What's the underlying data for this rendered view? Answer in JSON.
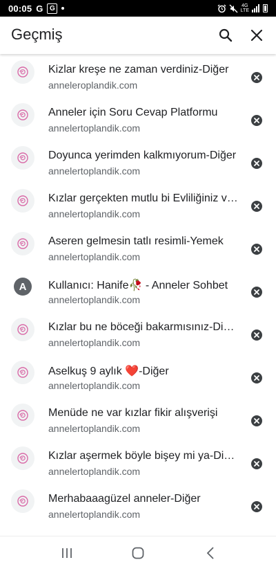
{
  "status_bar": {
    "time": "00:05",
    "left_icons": [
      "google-icon",
      "google-app-icon",
      "notification-dot-icon"
    ],
    "network": "4G",
    "network_sub": "LTE",
    "right_icons": [
      "alarm-icon",
      "mute-icon",
      "network-icon",
      "signal-icon",
      "battery-icon"
    ]
  },
  "header": {
    "title": "Geçmiş",
    "search_icon": "search-icon",
    "close_icon": "close-icon"
  },
  "history": [
    {
      "title": "Kizlar kreşe ne zaman verdiniz-Diğer",
      "url": "anneleroplandik.com",
      "icon": "rose-favicon"
    },
    {
      "title": "Anneler için Soru Cevap Platformu",
      "url": "annelertoplandik.com",
      "icon": "rose-favicon"
    },
    {
      "title": "Doyunca yerimden kalkmıyorum-Diğer",
      "url": "annelertoplandik.com",
      "icon": "rose-favicon"
    },
    {
      "title": "Kızlar gerçekten mutlu bi Evliliğiniz var mı",
      "url": "annelertoplandik.com",
      "icon": "rose-favicon"
    },
    {
      "title": "Aseren gelmesin tatlı resimli-Yemek",
      "url": "annelertoplandik.com",
      "icon": "rose-favicon"
    },
    {
      "title": "Kullanıcı: Hanife🥀 - Anneler Sohbet",
      "url": "annelertoplandik.com",
      "icon": "letter",
      "letter": "A"
    },
    {
      "title": "Kızlar bu ne böceği bakarmısınız-Diğer",
      "url": "annelertoplandik.com",
      "icon": "rose-favicon"
    },
    {
      "title": "Aselkuş 9 aylık ❤️-Diğer",
      "url": "annelertoplandik.com",
      "icon": "rose-favicon"
    },
    {
      "title": "Menüde ne var kızlar fikir alışverişi",
      "url": "annelertoplandik.com",
      "icon": "rose-favicon"
    },
    {
      "title": "Kızlar aşermek böyle bişey mi ya-Diğer",
      "url": "annelertoplandik.com",
      "icon": "rose-favicon"
    },
    {
      "title": "Merhabaaagüzel anneler-Diğer",
      "url": "annelertoplandik.com",
      "icon": "rose-favicon"
    }
  ],
  "nav_bar": {
    "items": [
      "recent-apps-icon",
      "home-icon",
      "back-icon"
    ]
  },
  "colors": {
    "favicon_accent": "#d96aa7",
    "remove_icon": "#3c4043",
    "title_text": "#202124",
    "url_text": "#5f6368"
  }
}
